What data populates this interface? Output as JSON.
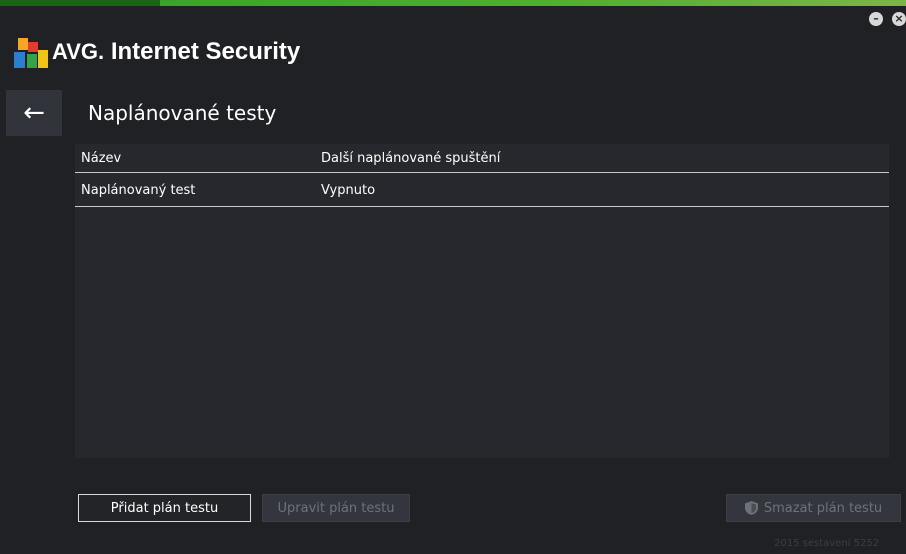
{
  "window": {
    "app_brand": "AVG.",
    "app_name": "Internet Security",
    "minimize_icon": "minimize-icon",
    "close_icon": "close-icon"
  },
  "page": {
    "title": "Naplánované testy",
    "back_icon": "back-arrow-icon"
  },
  "table": {
    "columns": [
      "Název",
      "Další naplánované spuštění"
    ],
    "rows": [
      {
        "name": "Naplánovaný test",
        "next_run": "Vypnuto"
      }
    ]
  },
  "buttons": {
    "add": "Přidat plán testu",
    "edit": "Upravit plán testu",
    "delete": "Smazat plán testu"
  },
  "footer": {
    "build": "2015  sestavení 5252"
  },
  "colors": {
    "accent_green": "#3aa52a",
    "background": "#1f2125",
    "panel": "#26282d"
  }
}
